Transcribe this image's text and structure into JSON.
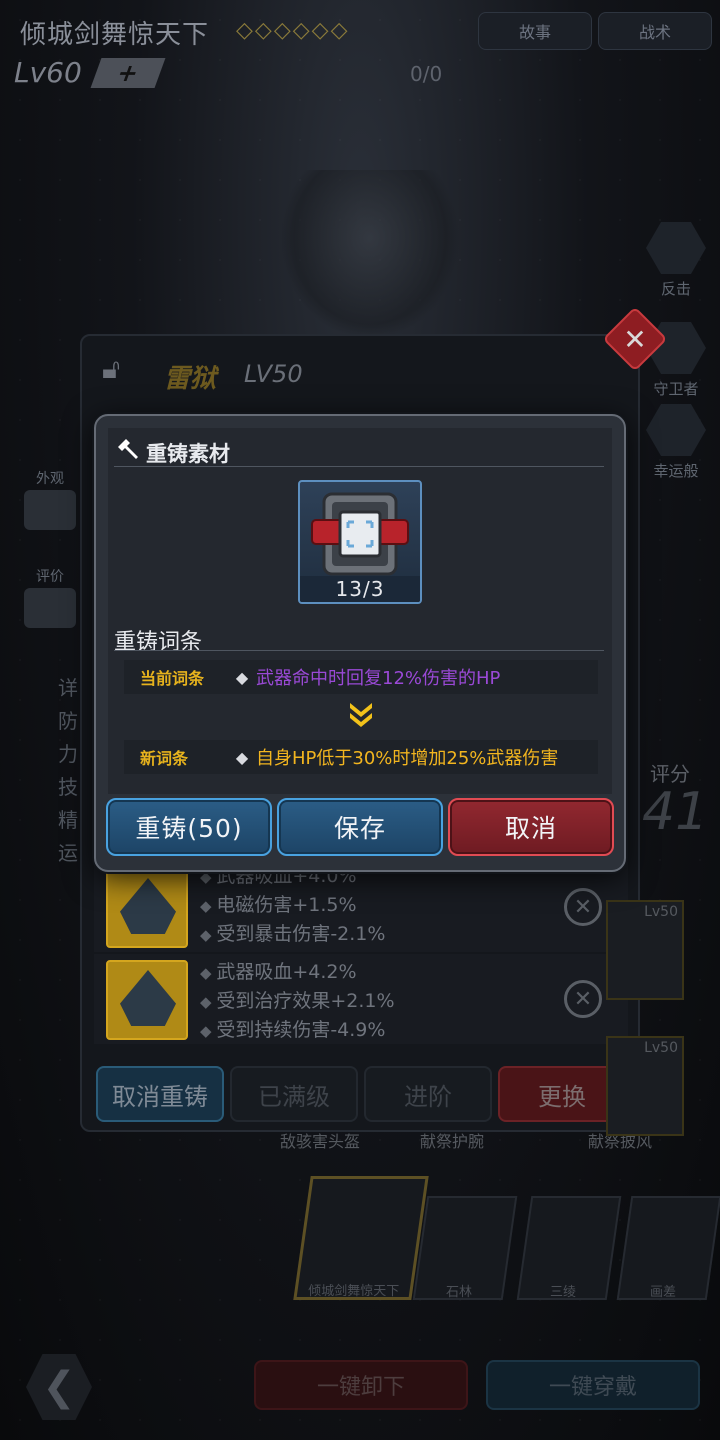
{
  "background": {
    "hero_title": "倾城剑舞惊天下",
    "stars": "◇◇◇◇◇◇",
    "top_buttons": [
      "故事",
      "战术"
    ],
    "level": "Lv60",
    "level_plus": "+",
    "exp": "0/0",
    "side_skills": [
      "反击",
      "守卫者",
      "幸运般"
    ],
    "left_icons": [
      "外观",
      "评价"
    ],
    "left_list": [
      "详",
      "防",
      "力",
      "技",
      "精",
      "运"
    ]
  },
  "equipment_panel": {
    "name": "雷狱",
    "level": "LV50",
    "close_symbol": "✕",
    "score_label": "评分",
    "score_value": "41",
    "affix_rows": [
      {
        "lines": [
          "武器吸血+4.0%",
          "电磁伤害+1.5%",
          "受到暴击伤害-2.1%"
        ]
      },
      {
        "lines": [
          "武器吸血+4.2%",
          "受到治疗效果+2.1%",
          "受到持续伤害-4.9%"
        ]
      }
    ],
    "buttons": {
      "cancel_reforge": "取消重铸",
      "maxed": "已满级",
      "advance": "进阶",
      "replace": "更换"
    },
    "sub_tabs": [
      "敌骇害头盔",
      "献祭护腕",
      "献祭披风"
    ],
    "right_cards": [
      "Lv50",
      "Lv50"
    ]
  },
  "portraits": [
    "倾城剑舞惊天下",
    "石林",
    "三绫",
    "画差"
  ],
  "bottom_bar": {
    "back_symbol": "❮",
    "unequip_all": "一键卸下",
    "equip_all": "一键穿戴"
  },
  "dialog": {
    "material_title": "重铸素材",
    "material_count": "13/3",
    "affix_title": "重铸词条",
    "current_tag": "当前词条",
    "current_value": "武器命中时回复12%伤害的HP",
    "new_tag": "新词条",
    "new_value": "自身HP低于30%时增加25%武器伤害",
    "diamond": "◆",
    "buttons": {
      "reforge": "重铸(50)",
      "save": "保存",
      "cancel": "取消"
    }
  },
  "colors": {
    "current_affix": "#9a49d6",
    "new_affix": "#f2b51f",
    "tag_gold": "#e6b21d",
    "button_blue_border": "#49a2e0",
    "button_red_border": "#e14b53"
  }
}
